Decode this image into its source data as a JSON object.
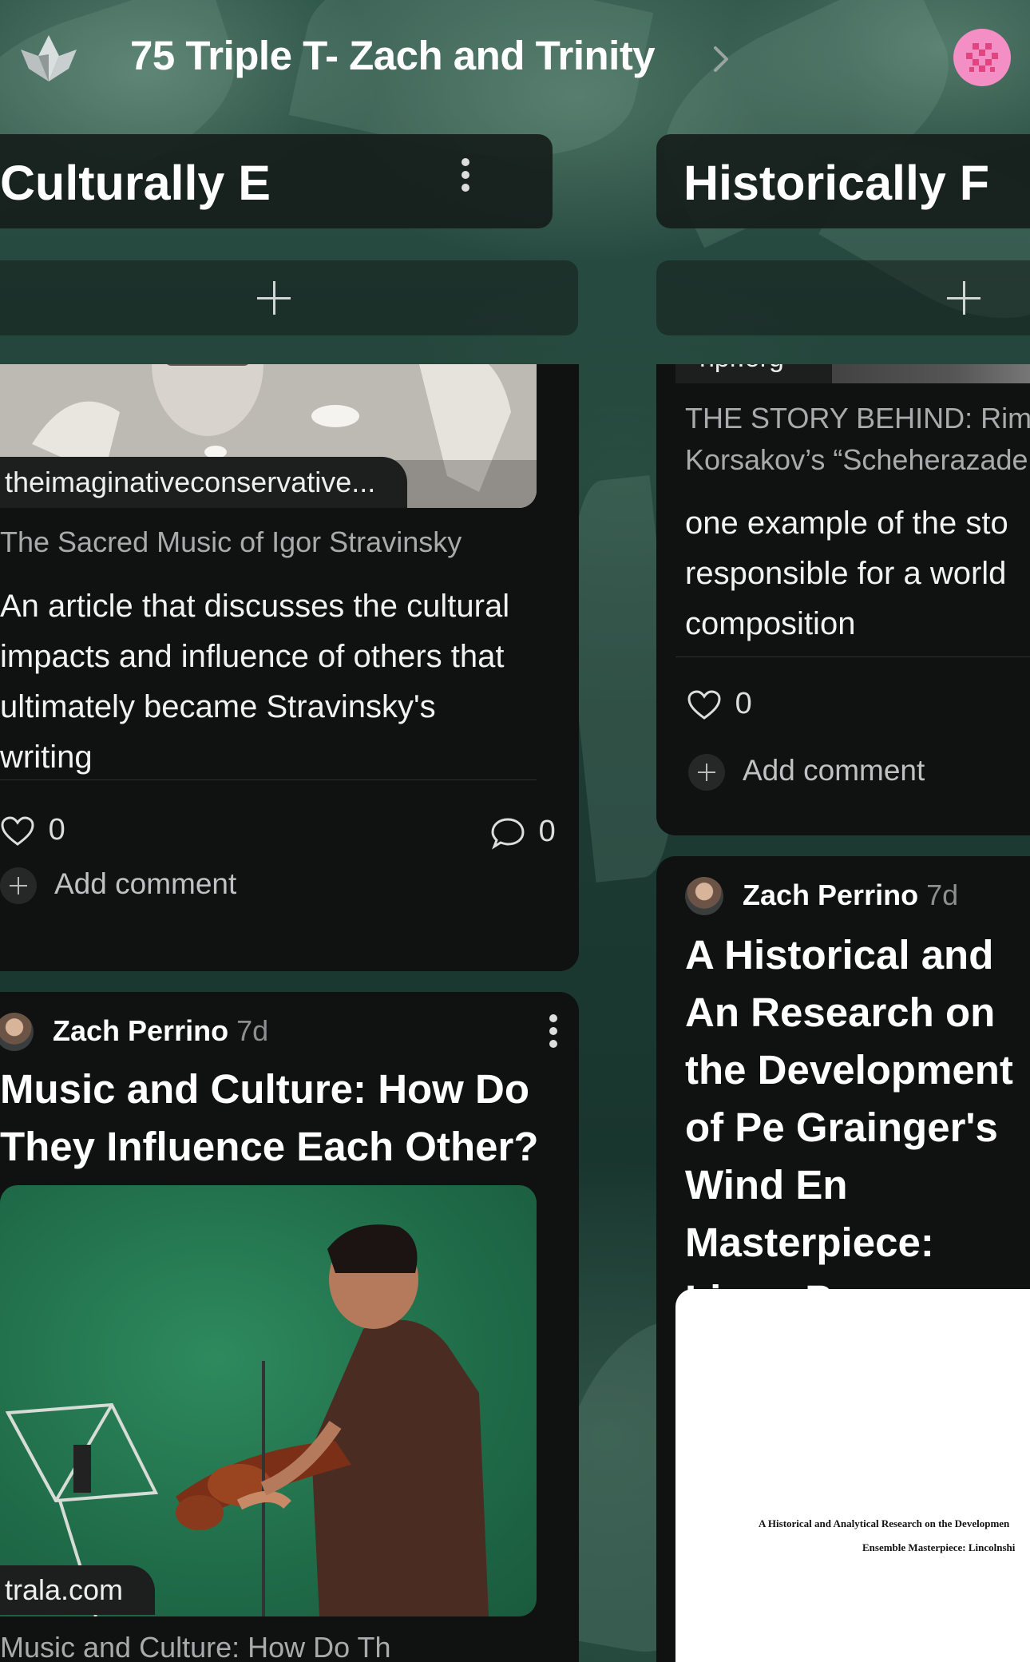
{
  "board": {
    "title": "75 Triple T- Zach and Trinity"
  },
  "columns": [
    {
      "title": "Culturally E",
      "cards": [
        {
          "source": "theimaginativeconservative...",
          "link_title": "The Sacred Music of Igor Stravinsky",
          "body": "An article that discusses the cultural impacts and influence of others that ultimately became Stravinsky's writing",
          "likes": "0",
          "comments": "0",
          "add_comment": "Add comment"
        },
        {
          "author": "Zach Perrino",
          "ago": "7d",
          "title": "Music and Culture: How Do They Influence Each Other?",
          "source": "trala.com",
          "link_title_partial": "Music and Culture: How Do Th"
        }
      ]
    },
    {
      "title": "Historically F",
      "cards": [
        {
          "source_partial": "npr.org",
          "link_title": "THE STORY BEHIND: Rim Korsakov’s “Scheherazade",
          "body": "one example of the sto responsible for a world composition",
          "likes": "0",
          "add_comment": "Add comment"
        },
        {
          "author": "Zach Perrino",
          "ago": "7d",
          "title": "A Historical and An Research on the Development of Pe Grainger's Wind En Masterpiece: Linco Posy",
          "doc_line1": "A Historical and Analytical Research on the Developmen",
          "doc_line2": "Ensemble Masterpiece: Lincolnshi"
        }
      ]
    }
  ],
  "colors": {
    "card_bg": "#101111",
    "avatar_pink": "#f38fc4",
    "background": "#1e3d34"
  },
  "icons": [
    "padlet-logo-icon",
    "chevron-right-icon",
    "kebab-menu-icon",
    "plus-icon",
    "heart-icon",
    "comment-icon",
    "add-comment-icon"
  ]
}
